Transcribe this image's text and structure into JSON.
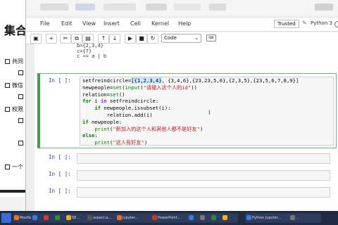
{
  "slide": {
    "heading": "集合",
    "bullets": [
      "共同",
      "微信",
      "权限",
      "一个"
    ]
  },
  "menubar": {
    "items": [
      "File",
      "Edit",
      "View",
      "Insert",
      "Cell",
      "Kernel",
      "Help"
    ],
    "trusted": "Trusted",
    "kernel": "Python 3"
  },
  "toolbar": {
    "cell_type": "Code",
    "buttons": [
      "save-icon",
      "add-icon",
      "cut-icon",
      "copy-icon",
      "paste-icon",
      "move-up-icon",
      "move-down-icon",
      "run-icon",
      "stop-icon",
      "restart-icon",
      "fast-forward-icon",
      "keyboard-icon"
    ]
  },
  "notebook": {
    "prev_cell_lines": [
      "b={2,3,4}",
      "c={7}",
      "c <= a | b"
    ],
    "active_prompt": "In [ ]:",
    "code_lines": [
      "setfreindcircle=[{1,2,3,4}, {3,4,6},{23,23,5,6},{2,3,5},{23,5,6,7,8,9}]",
      "newpeople=set(input(\"请输入这个人的id\"))",
      "relation=set()",
      "for i in setfreindcircle:",
      "    if newpeople.issubset(i):",
      "        relation.add(i)",
      "if newpeople:",
      "    print(\"新加入的这个人和其他人都不是好友\")",
      "else:",
      "    print(\"这人有好友\")"
    ],
    "empty_prompts": [
      "In [ ]:",
      "In [ ]:",
      "In [ ]:"
    ]
  },
  "taskbar": {
    "items": [
      "Mozilla...",
      "",
      "",
      "",
      "",
      "SE...",
      "aspect:a...",
      "Jupyter...",
      "PowerPoint...",
      "",
      "",
      "",
      "",
      "Python Jupyter...",
      "..."
    ],
    "colors": [
      "#e8712b",
      "#3a7bd5",
      "#d33",
      "#2b8a3e",
      "#f2b01e",
      "#555",
      "#3a7bd5",
      "#e8712b",
      "#c0392b",
      "#777"
    ]
  }
}
